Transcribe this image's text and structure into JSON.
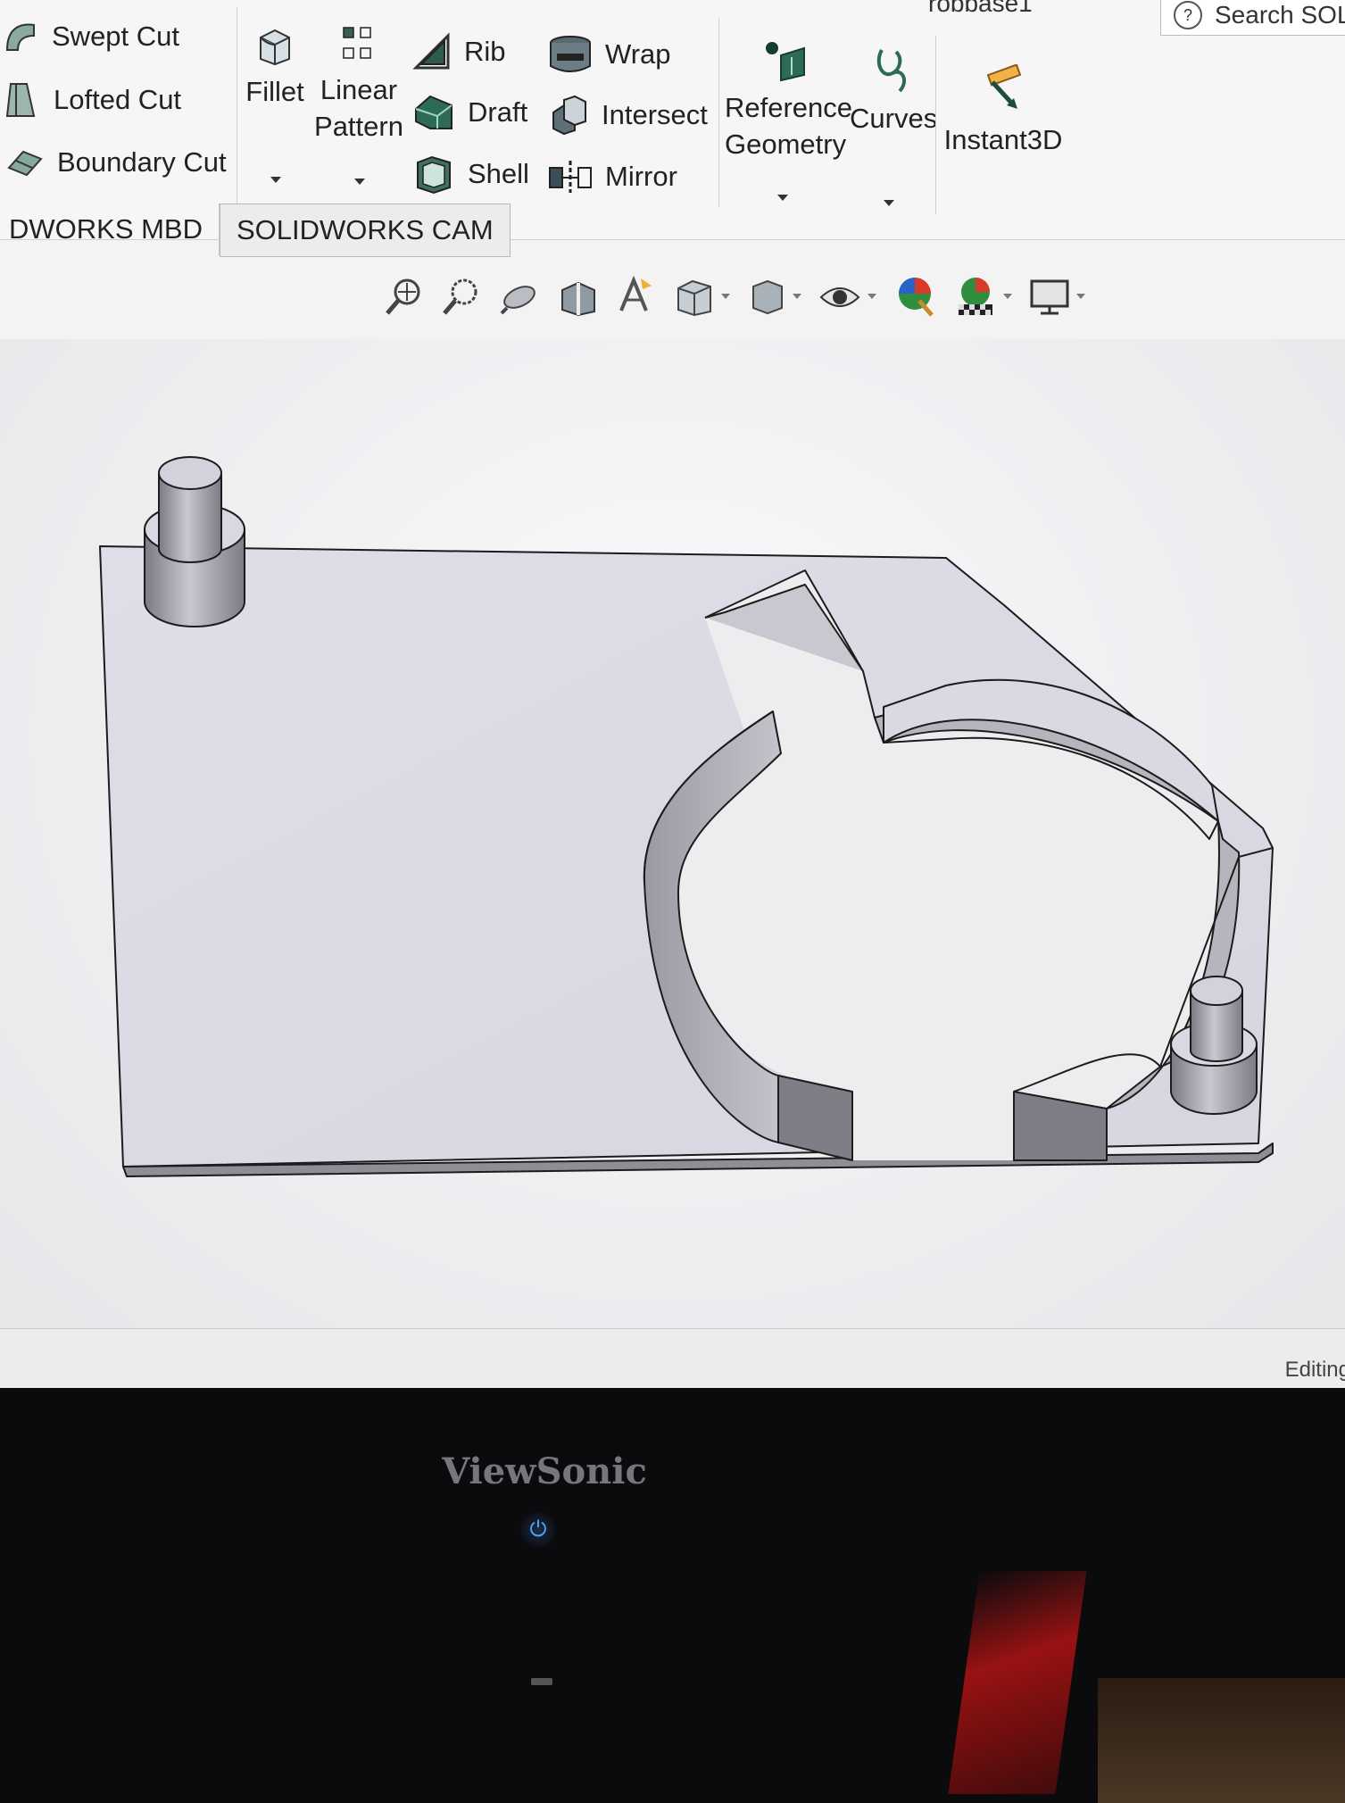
{
  "window": {
    "title_fragment": "robbase1",
    "search_label": "Search SOLI"
  },
  "ribbon": {
    "cuts": [
      "Swept Cut",
      "Lofted Cut",
      "Boundary Cut"
    ],
    "fillet": "Fillet",
    "linear_pattern": [
      "Linear",
      "Pattern"
    ],
    "features_a": [
      "Rib",
      "Draft",
      "Shell"
    ],
    "features_b": [
      "Wrap",
      "Intersect",
      "Mirror"
    ],
    "reference_geometry": [
      "Reference",
      "Geometry"
    ],
    "curves": "Curves",
    "instant3d": "Instant3D"
  },
  "tabs": [
    "DWORKS MBD",
    "SOLIDWORKS CAM"
  ],
  "heads_up_toolbar": {
    "icons": [
      "zoom-to-fit-icon",
      "zoom-to-area-icon",
      "previous-view-icon",
      "section-view-icon",
      "dynamic-annotation-icon",
      "view-orientation-icon",
      "display-style-icon",
      "hide-show-icon",
      "edit-appearance-icon",
      "apply-scene-icon",
      "view-settings-icon"
    ]
  },
  "status": {
    "text": "Editing"
  },
  "monitor": {
    "brand": "ViewSonic"
  },
  "colors": {
    "model_face": "#dcdce6",
    "model_edge": "#1c1c1c",
    "model_side": "#8e8e96"
  }
}
